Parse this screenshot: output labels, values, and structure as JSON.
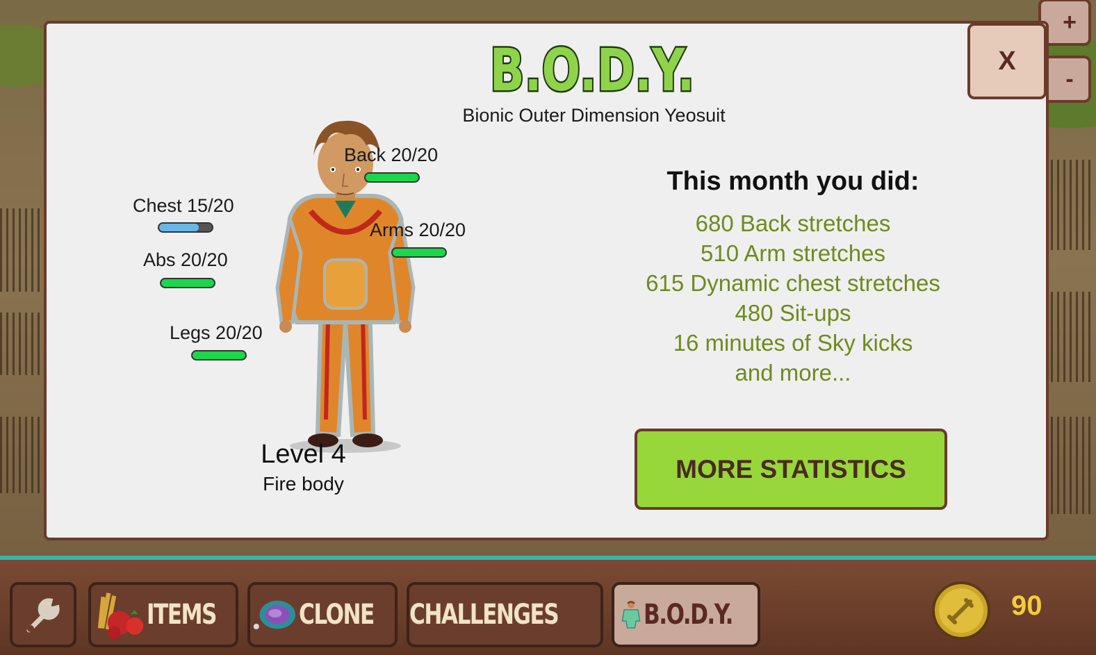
{
  "header": {
    "logo_text": "B.O.D.Y.",
    "subtitle": "Bionic Outer Dimension Yeosuit",
    "close_label": "X",
    "zoom_in_label": "+",
    "zoom_out_label": "-"
  },
  "body_stats": [
    {
      "name": "Back",
      "label": "Back 20/20",
      "value": 20,
      "max": 20,
      "color": "#19d84a"
    },
    {
      "name": "Chest",
      "label": "Chest 15/20",
      "value": 15,
      "max": 20,
      "color": "#6ab8e8"
    },
    {
      "name": "Arms",
      "label": "Arms 20/20",
      "value": 20,
      "max": 20,
      "color": "#19d84a"
    },
    {
      "name": "Abs",
      "label": "Abs 20/20",
      "value": 20,
      "max": 20,
      "color": "#19d84a"
    },
    {
      "name": "Legs",
      "label": "Legs 20/20",
      "value": 20,
      "max": 20,
      "color": "#19d84a"
    }
  ],
  "level": {
    "title": "Level 4",
    "body_type": "Fire body"
  },
  "monthly": {
    "title": "This month you did:",
    "items": [
      "680 Back stretches",
      "510 Arm stretches",
      "615 Dynamic chest stretches",
      "480 Sit-ups",
      "16 minutes of Sky kicks",
      "and more..."
    ]
  },
  "more_statistics_label": "MORE STATISTICS",
  "toolbar": {
    "settings_icon": "wrench-icon",
    "items_label": "ITEMS",
    "clone_label": "CLONE",
    "challenges_label": "CHALLENGES",
    "body_label": "B.O.D.Y.",
    "coins": "90"
  },
  "colors": {
    "accent_green": "#97d73a",
    "stat_green": "#6f8a1e",
    "modal_border": "#6a3a2a",
    "coin": "#f3cd3a"
  }
}
